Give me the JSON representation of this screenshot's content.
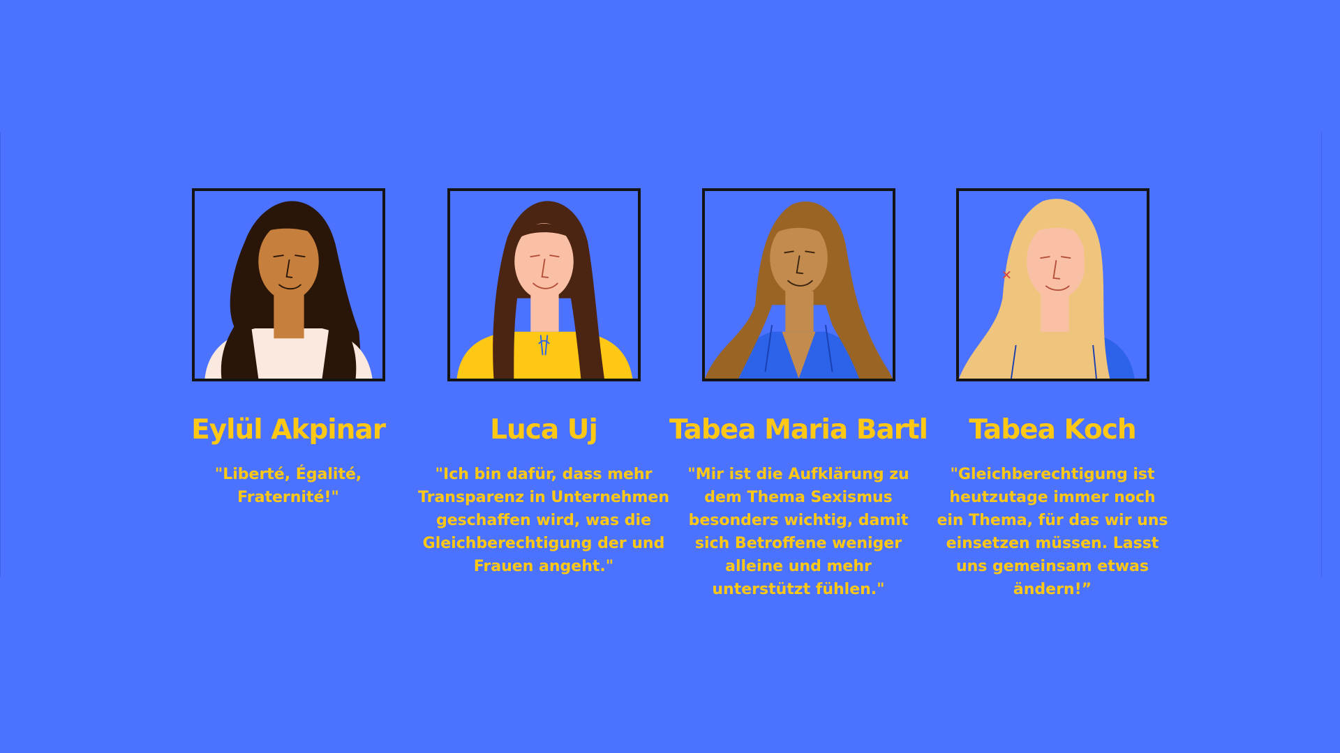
{
  "team": [
    {
      "name": "Eylül Akpinar",
      "quote": "\"Liberté, Égalité, Fraternité!\"",
      "portrait": {
        "icon": "portrait-illustration-icon",
        "skin": "#C77F3D",
        "hair": "#2A1608",
        "top": "#FBE9DF"
      }
    },
    {
      "name": "Luca Uj",
      "quote": "\"Ich bin dafür, dass mehr\nTransparenz in Unternehmen\ngeschaffen wird, was die\nGleichberechtigung der und\nFrauen angeht.\"",
      "portrait": {
        "icon": "portrait-illustration-icon",
        "skin": "#F9C0A5",
        "hair": "#4B2412",
        "top": "#FFC815"
      }
    },
    {
      "name": "Tabea Maria Bartl",
      "quote": "\"Mir ist die Aufklärung zu\ndem Thema Sexismus\nbesonders wichtig, damit\nsich Betroffene weniger\nalleine und mehr\nunterstützt fühlen.\"",
      "portrait": {
        "icon": "portrait-illustration-icon",
        "skin": "#C48B4E",
        "hair": "#9A6424",
        "top": "#2D63E8"
      }
    },
    {
      "name": "Tabea Koch",
      "quote": "\"Gleichberechtigung ist\nheutzutage immer noch\nein Thema, für das wir uns\neinsetzen müssen. Lasst\nuns gemeinsam etwas\nändern!”",
      "portrait": {
        "icon": "portrait-illustration-icon",
        "skin": "#F9C0A5",
        "hair": "#EFC57E",
        "top": "#2D63E8"
      }
    }
  ],
  "colors": {
    "background": "#4B73FF",
    "accent_text": "#FFC815",
    "frame": "#141414"
  }
}
